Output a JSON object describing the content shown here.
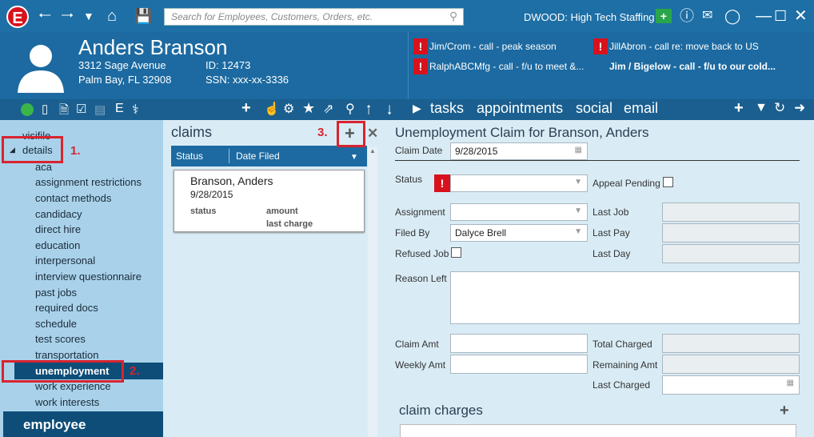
{
  "topbar": {
    "search_placeholder": "Search for Employees, Customers, Orders, etc.",
    "user": "DWOOD: High Tech Staffing"
  },
  "record": {
    "name": "Anders Branson",
    "address1": "3312 Sage Avenue",
    "address2": "Palm Bay, FL 32908",
    "id_label": "ID: 12473",
    "ssn_label": "SSN: xxx-xx-3336"
  },
  "messages": [
    {
      "text": "Jim/Crom - call - peak season",
      "bold": false
    },
    {
      "text": "JillAbron - call re: move back to US",
      "bold": false
    },
    {
      "text": "RalphABCMfg - call - f/u to meet &...",
      "bold": false
    },
    {
      "text": "Jim / Bigelow - call - f/u to our cold...",
      "bold": true
    }
  ],
  "activity_tabs": [
    "tasks",
    "appointments",
    "social",
    "email"
  ],
  "sidebar": {
    "top_item": "visifile",
    "group": "details",
    "items": [
      "aca",
      "assignment restrictions",
      "contact methods",
      "candidacy",
      "direct hire",
      "education",
      "interpersonal",
      "interview questionnaire",
      "past jobs",
      "required docs",
      "schedule",
      "test scores",
      "transportation",
      "unemployment",
      "work experience",
      "work interests"
    ],
    "selected": "unemployment",
    "section": "employee"
  },
  "callouts": {
    "one": "1.",
    "two": "2.",
    "three": "3."
  },
  "claims": {
    "title": "claims",
    "col_status": "Status",
    "col_date": "Date Filed",
    "card": {
      "name": "Branson, Anders",
      "date": "9/28/2015",
      "status_label": "status",
      "amount_label": "amount",
      "last_charge_label": "last charge"
    }
  },
  "detail": {
    "title": "Unemployment Claim for Branson, Anders",
    "claim_date_label": "Claim Date",
    "claim_date": "9/28/2015",
    "status_label": "Status",
    "appeal_label": "Appeal Pending",
    "assignment_label": "Assignment",
    "last_job_label": "Last Job",
    "filed_by_label": "Filed By",
    "filed_by": "Dalyce Brell",
    "last_pay_label": "Last Pay",
    "refused_label": "Refused Job",
    "last_day_label": "Last Day",
    "reason_label": "Reason Left",
    "claim_amt_label": "Claim Amt",
    "total_charged_label": "Total Charged",
    "weekly_amt_label": "Weekly Amt",
    "remaining_label": "Remaining Amt",
    "last_charged_label": "Last Charged",
    "charges_title": "claim charges"
  },
  "colors": {
    "brand": "#1c6aa1",
    "accent_red": "#d8242f",
    "sidebar": "#a9d2ea"
  }
}
